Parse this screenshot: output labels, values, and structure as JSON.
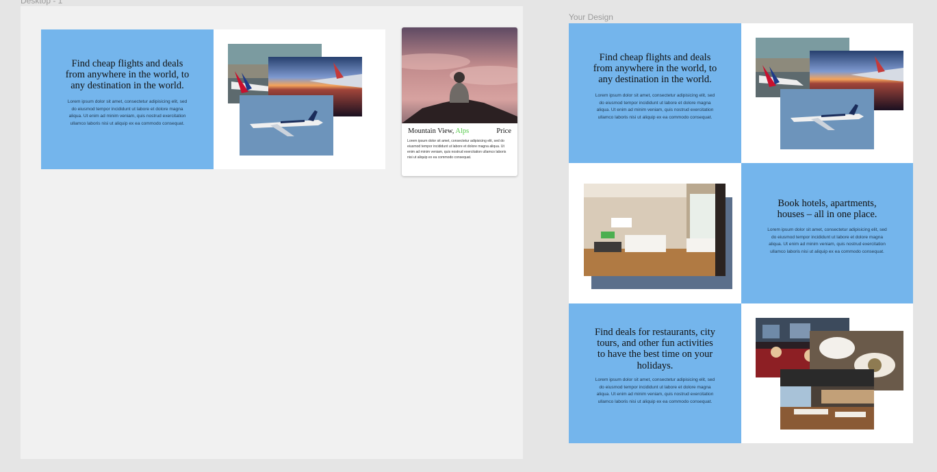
{
  "canvas": {
    "frame1_label": "Desktop - 1",
    "frame2_label": "Your Design"
  },
  "lorem": "Lorem ipsum dolor sit amet, consectetur adipisicing elit, sed do eiusmod tempor incididunt ut labore et dolore magna aliqua. Ut enim ad minim veniam, quis nostrud exercitation ullamco laboris nisi ut aliquip ex ea commodo consequat.",
  "desktop": {
    "flights": {
      "heading": "Find cheap flights and deals from anywhere in the world, to any destination in the world."
    },
    "card": {
      "title_prefix": "Mountain View,",
      "title_accent": "Alps",
      "price": "Price",
      "text": "Lorem ipsum dolor sit amet, consectetur adipisicing elit, sed do eiusmod tempor incididunt ut labore et dolore magna aliqua. Ut enim ad minim veniam, quis nostrud exercitation ullamco laboris nisi ut aliquip ex ea commodo consequat."
    }
  },
  "design": {
    "flights": {
      "heading": "Find cheap flights and deals from anywhere in the world, to any destination in the world."
    },
    "hotels": {
      "heading": "Book hotels, apartments, houses – all in one place."
    },
    "restaurants": {
      "heading": "Find deals for restaurants, city tours, and other fun activities to have the best time on your holidays."
    }
  },
  "colors": {
    "blue_panel": "#74b5ec",
    "accent_green": "#55c94a",
    "hotel_shadow": "#5b6f8b"
  }
}
